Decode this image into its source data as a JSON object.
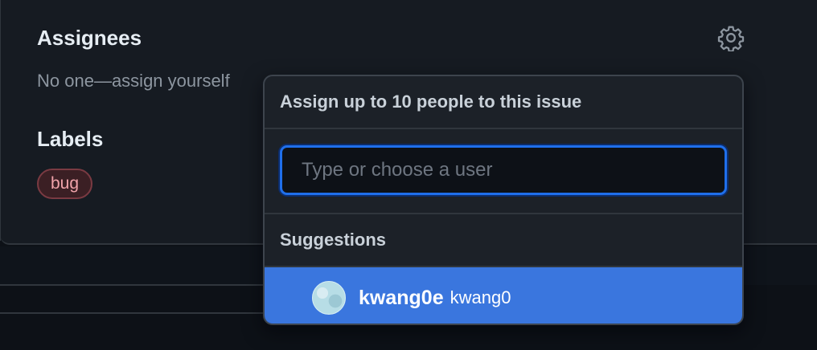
{
  "sidebar": {
    "assignees_title": "Assignees",
    "assignees_empty_text": "No one—assign yourself",
    "labels_title": "Labels",
    "labels": [
      {
        "name": "bug",
        "color": "#f0a3aa"
      }
    ]
  },
  "assign_popover": {
    "header": "Assign up to 10 people to this issue",
    "search_placeholder": "Type or choose a user",
    "search_value": "",
    "suggestions_title": "Suggestions",
    "suggestions": [
      {
        "login": "kwang0e",
        "name": "kwang0",
        "selected": true
      }
    ]
  },
  "icons": {
    "settings": "gear-icon"
  },
  "colors": {
    "accent": "#1f6feb",
    "selected_row": "#3a76de",
    "label_bug_bg": "#3b1f24"
  }
}
